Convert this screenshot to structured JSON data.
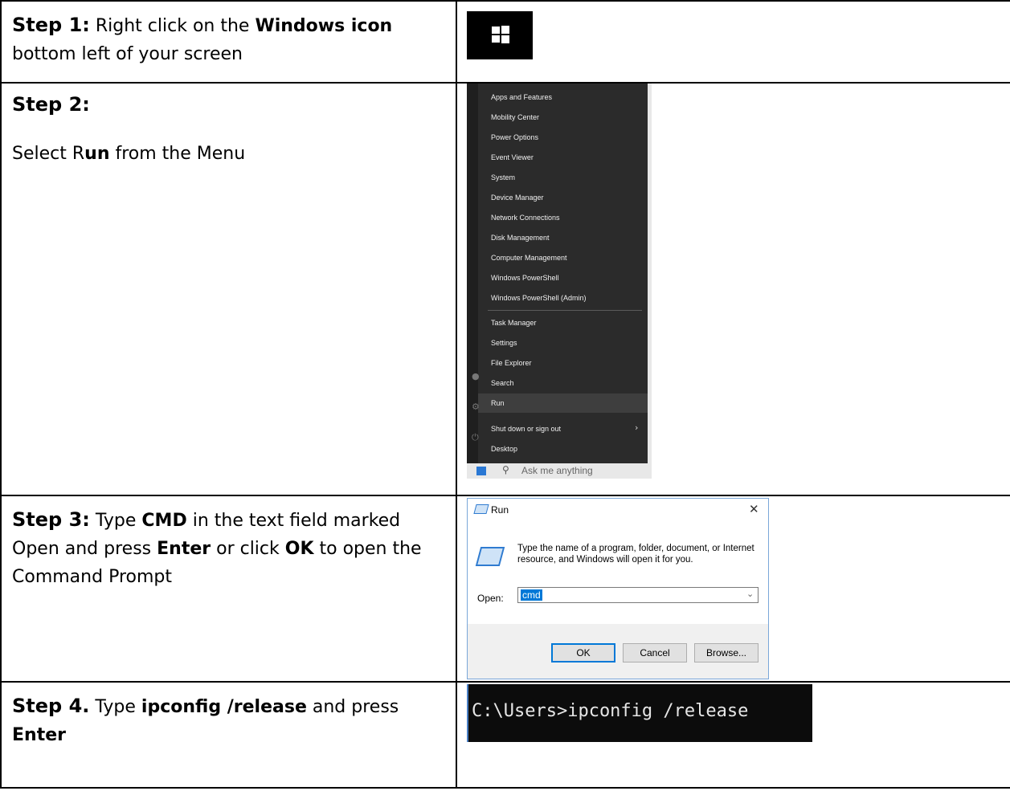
{
  "steps": [
    {
      "heading": "Step 1:",
      "text_parts": [
        "Right click on the ",
        "Windows icon",
        " bottom left of your screen"
      ]
    },
    {
      "heading": "Step 2:",
      "text_parts": [
        "Select R",
        "un",
        " from the Menu"
      ]
    },
    {
      "heading": "Step 3:",
      "text_parts": [
        "Type ",
        "CMD",
        " in the text field marked Open and press ",
        "Enter",
        " or click ",
        "OK",
        " to open the Command Prompt"
      ]
    },
    {
      "heading": "Step 4.",
      "text_parts": [
        "Type ",
        "ipconfig /release",
        " and press ",
        "Enter"
      ]
    }
  ],
  "winx_menu": {
    "items": [
      "Apps and Features",
      "Mobility Center",
      "Power Options",
      "Event Viewer",
      "System",
      "Device Manager",
      "Network Connections",
      "Disk Management",
      "Computer Management",
      "Windows PowerShell",
      "Windows PowerShell (Admin)",
      "Task Manager",
      "Settings",
      "File Explorer",
      "Search",
      "Run",
      "Shut down or sign out",
      "Desktop"
    ],
    "highlighted": "Run",
    "taskbar_search": "Ask me anything"
  },
  "run_dialog": {
    "title": "Run",
    "description": "Type the name of a program, folder, document, or Internet resource, and Windows will open it for you.",
    "open_label": "Open:",
    "open_value": "cmd",
    "ok_label": "OK",
    "cancel_label": "Cancel",
    "browse_label": "Browse..."
  },
  "console": {
    "text": "C:\\Users>ipconfig /release"
  },
  "colors": {
    "menu_bg": "#2b2b2b",
    "selection_blue": "#0078d7",
    "console_bg": "#0c0c0c"
  }
}
